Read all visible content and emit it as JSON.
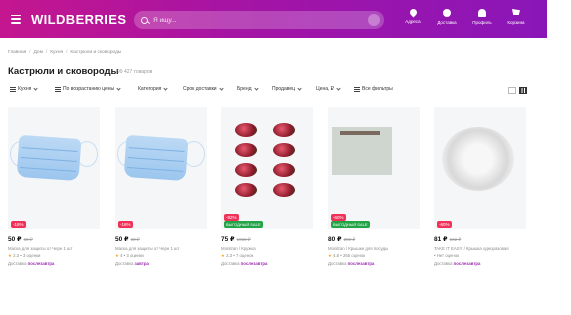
{
  "header": {
    "logo": "WILDBERRIES",
    "search_placeholder": "Я ищу...",
    "nav": [
      {
        "label": "Адреса",
        "icon": "location-pin-icon"
      },
      {
        "label": "Доставка",
        "icon": "delivery-icon"
      },
      {
        "label": "Профиль",
        "icon": "user-icon"
      },
      {
        "label": "Корзина",
        "icon": "cart-icon"
      }
    ],
    "colors": {
      "gradient_start": "#c4168f",
      "gradient_end": "#8a16b8"
    }
  },
  "breadcrumb": [
    "Главная",
    "Дом",
    "Кухня",
    "Кастрюли и сковороды"
  ],
  "page": {
    "title": "Кастрюли и сковороды",
    "count": "99 427 товаров"
  },
  "filters": [
    {
      "label": "Кухня"
    },
    {
      "label": "По возрастанию цены"
    },
    {
      "label": "Категория"
    },
    {
      "label": "Срок доставки"
    },
    {
      "label": "Бренд"
    },
    {
      "label": "Продавец"
    },
    {
      "label": "Цена, ₽"
    },
    {
      "label": "Все фильтры"
    }
  ],
  "products": [
    {
      "discount": "-16%",
      "price": "50 ₽",
      "old_price": "60 ₽",
      "name": "Маска для защиты от Черн 1 шт",
      "rating": "2.3",
      "reviews": "• 3 оценки",
      "delivery_prefix": "Доставка",
      "delivery": "послезавтра"
    },
    {
      "discount": "-16%",
      "price": "50 ₽",
      "old_price": "60 ₽",
      "name": "Маска для защиты от Черн 1 шт",
      "rating": "4",
      "reviews": "• 3 оценки",
      "delivery_prefix": "Доставка",
      "delivery": "завтра"
    },
    {
      "discount": "-92%",
      "green": "ВЫГОДНЫЙ SALE",
      "price": "75 ₽",
      "old_price": "1060 ₽",
      "name": "Monitran / Кружка",
      "rating": "2.3",
      "reviews": "• 7 оценок",
      "delivery_prefix": "Доставка",
      "delivery": "послезавтра"
    },
    {
      "discount": "-60%",
      "green": "ВЫГОДНЫЙ SALE",
      "price": "80 ₽",
      "old_price": "200 ₽",
      "name": "Monitran / Крышки для посуды",
      "rating": "4.8",
      "reviews": "• 265 оценок",
      "delivery_prefix": "Доставка",
      "delivery": "послезавтра"
    },
    {
      "discount": "-60%",
      "price": "81 ₽",
      "old_price": "162 ₽",
      "name": "TAKE IT EASY / Крышка одноразовая",
      "rating": "",
      "reviews": "• Нет оценок",
      "delivery_prefix": "Доставка",
      "delivery": "послезавтра"
    }
  ]
}
